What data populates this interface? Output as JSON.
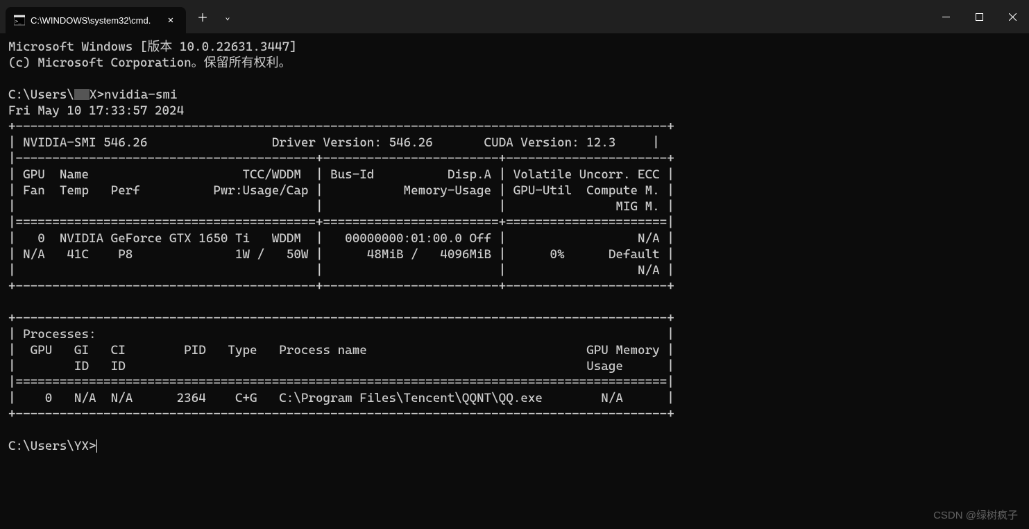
{
  "titlebar": {
    "tab_title": "C:\\WINDOWS\\system32\\cmd.",
    "close_glyph": "✕",
    "plus_glyph": "＋",
    "chevron_glyph": "⌄"
  },
  "terminal": {
    "header_line1": "Microsoft Windows [版本 10.0.22631.3447]",
    "header_line2": "(c) Microsoft Corporation。保留所有权利。",
    "prompt1_prefix": "C:\\Users\\",
    "prompt1_redacted": "X>",
    "prompt1_cmd": "nvidia-smi",
    "timestamp": "Fri May 10 17:33:57 2024",
    "smi": {
      "border_top": "+-----------------------------------------------------------------------------------------+",
      "version_line": "| NVIDIA-SMI 546.26                 Driver Version: 546.26       CUDA Version: 12.3     |",
      "sep_thin": "|-----------------------------------------+------------------------+----------------------+",
      "hdr1": "| GPU  Name                     TCC/WDDM  | Bus-Id          Disp.A | Volatile Uncorr. ECC |",
      "hdr2": "| Fan  Temp   Perf          Pwr:Usage/Cap |           Memory-Usage | GPU-Util  Compute M. |",
      "hdr3": "|                                         |                        |               MIG M. |",
      "sep_thick": "|=========================================+========================+======================|",
      "gpu1": "|   0  NVIDIA GeForce GTX 1650 Ti   WDDM  |   00000000:01:00.0 Off |                  N/A |",
      "gpu2": "| N/A   41C    P8              1W /   50W |      48MiB /   4096MiB |      0%      Default |",
      "gpu3": "|                                         |                        |                  N/A |",
      "border_mid": "+-----------------------------------------+------------------------+----------------------+",
      "proc_top": "+-----------------------------------------------------------------------------------------+",
      "proc_title": "| Processes:                                                                              |",
      "proc_hdr1": "|  GPU   GI   CI        PID   Type   Process name                              GPU Memory |",
      "proc_hdr2": "|        ID   ID                                                               Usage      |",
      "proc_sep": "|=========================================================================================|",
      "proc_row1": "|    0   N/A  N/A      2364    C+G   C:\\Program Files\\Tencent\\QQNT\\QQ.exe        N/A      |",
      "proc_bottom": "+-----------------------------------------------------------------------------------------+"
    },
    "prompt2": "C:\\Users\\YX>"
  },
  "watermark": "CSDN @绿树疯子"
}
